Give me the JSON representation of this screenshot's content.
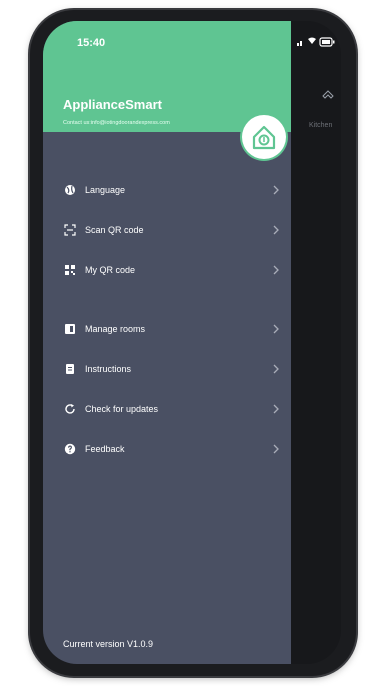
{
  "status_bar": {
    "time": "15:40"
  },
  "header": {
    "app_name": "ApplianceSmart",
    "contact": "Contact us:info@iotingdoorandexpress.com"
  },
  "menu": [
    {
      "label": "Language",
      "icon": "globe-icon"
    },
    {
      "label": "Scan QR code",
      "icon": "scan-icon"
    },
    {
      "label": "My QR code",
      "icon": "qr-code-icon"
    },
    {
      "label": "Manage rooms",
      "icon": "room-icon"
    },
    {
      "label": "Instructions",
      "icon": "book-icon"
    },
    {
      "label": "Check for updates",
      "icon": "refresh-icon"
    },
    {
      "label": "Feedback",
      "icon": "help-icon"
    }
  ],
  "footer": {
    "version": "Current version V1.0.9"
  },
  "background_panel": {
    "label": "Kitchen"
  },
  "colors": {
    "header_green": "#5fc592",
    "drawer_bg": "#4a5063",
    "background_dark": "#17181b"
  }
}
